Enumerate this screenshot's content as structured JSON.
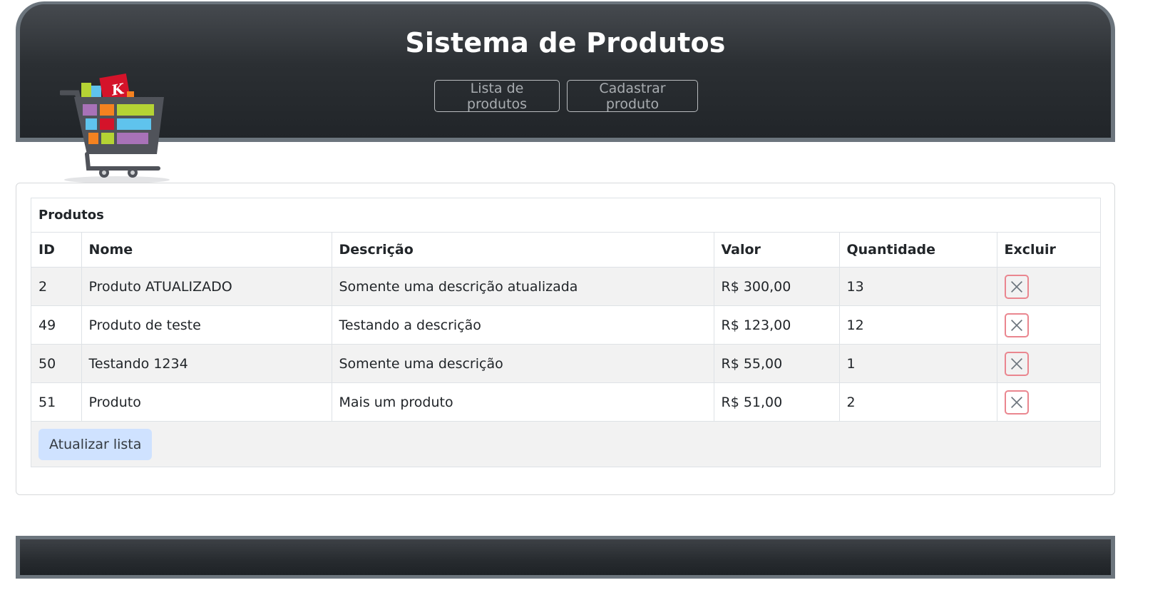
{
  "header": {
    "title": "Sistema de Produtos",
    "nav": [
      {
        "label": "Lista de produtos"
      },
      {
        "label": "Cadastrar produto"
      }
    ],
    "logo_icon": "shopping-cart-icon"
  },
  "products_table": {
    "caption": "Produtos",
    "columns": [
      "ID",
      "Nome",
      "Descrição",
      "Valor",
      "Quantidade",
      "Excluir"
    ],
    "rows": [
      {
        "id": "2",
        "nome": "Produto ATUALIZADO",
        "descricao": "Somente uma descrição atualizada",
        "valor": "R$ 300,00",
        "quantidade": "13"
      },
      {
        "id": "49",
        "nome": "Produto de teste",
        "descricao": "Testando a descrição",
        "valor": "R$ 123,00",
        "quantidade": "12"
      },
      {
        "id": "50",
        "nome": "Testando 1234",
        "descricao": "Somente uma descrição",
        "valor": "R$ 55,00",
        "quantidade": "1"
      },
      {
        "id": "51",
        "nome": "Produto",
        "descricao": "Mais um produto",
        "valor": "R$ 51,00",
        "quantidade": "2"
      }
    ],
    "delete_icon": "close-icon",
    "refresh_label": "Atualizar lista"
  },
  "colors": {
    "header_bg": "#212529",
    "border": "#6c757d",
    "delete_border": "#ea868f",
    "refresh_bg": "#cfe2ff",
    "striped_row": "#f2f2f2"
  }
}
